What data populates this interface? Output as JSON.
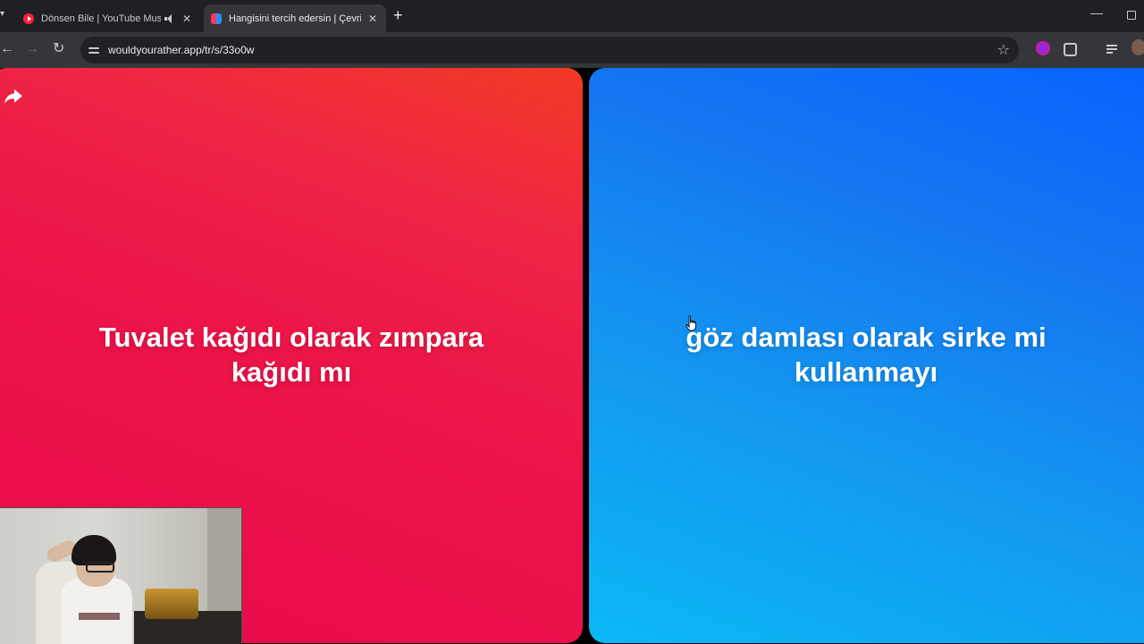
{
  "browser": {
    "tabs": [
      {
        "title": "Dönsen Bile | YouTube Music",
        "favicon": "youtube-music-icon",
        "audio": true,
        "active": false
      },
      {
        "title": "Hangisini tercih edersin | Çevrimiçi",
        "favicon": "wouldyourather-icon",
        "audio": false,
        "active": true
      }
    ],
    "url": "wouldyourather.app/tr/s/33o0w"
  },
  "page": {
    "option_left": "Tuvalet kağıdı olarak zımpara kağıdı mı",
    "option_right": "göz damlası olarak sirke mi kullanmayı"
  },
  "colors": {
    "left_card": "#ec1448",
    "right_card": "#1577f0",
    "tabbar": "#1f2023",
    "toolbar": "#35363a"
  }
}
